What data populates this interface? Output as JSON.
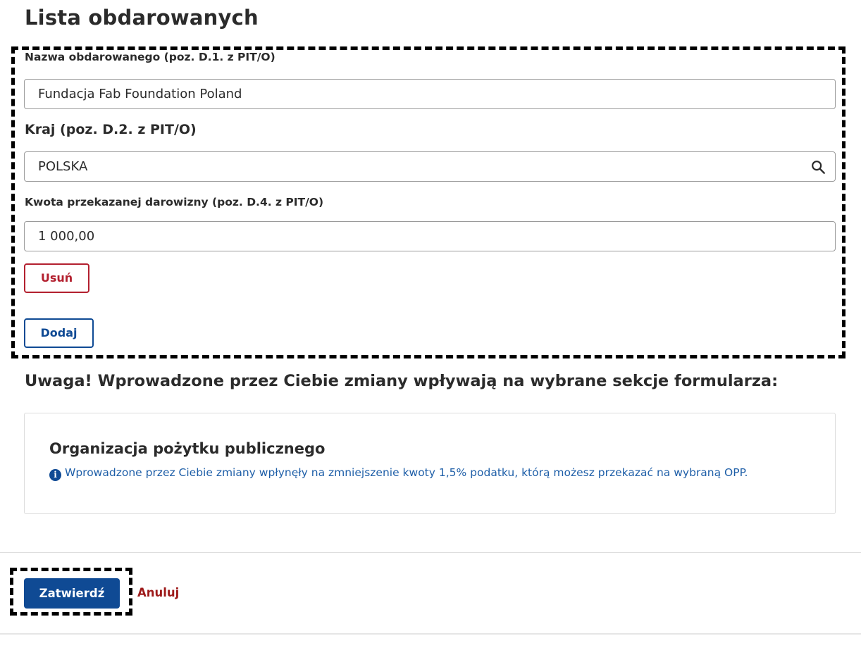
{
  "page": {
    "title": "Lista obdarowanych"
  },
  "form": {
    "recipient_name": {
      "label": "Nazwa obdarowanego (poz. D.1. z PIT/O)",
      "value": "Fundacja Fab Foundation Poland"
    },
    "country": {
      "label": "Kraj (poz. D.2. z PIT/O)",
      "value": "POLSKA",
      "icon": "search-icon"
    },
    "amount": {
      "label": "Kwota przekazanej darowizny (poz. D.4. z PIT/O)",
      "value": "1 000,00"
    },
    "remove_label": "Usuń",
    "add_label": "Dodaj"
  },
  "warning": {
    "heading": "Uwaga! Wprowadzone przez Ciebie zmiany wpływają na wybrane sekcje formularza:",
    "card_title": "Organizacja pożytku publicznego",
    "card_icon": "info-icon",
    "card_icon_glyph": "i",
    "card_note": "Wprowadzone przez Ciebie zmiany wpłynęły na zmniejszenie kwoty 1,5% podatku, którą możesz przekazać na wybraną OPP."
  },
  "footer": {
    "confirm_label": "Zatwierdź",
    "cancel_label": "Anuluj"
  },
  "colors": {
    "primary": "#0f4a94",
    "danger": "#b3202f",
    "info_text": "#1f5fa8",
    "cancel_link": "#9e1b1b"
  }
}
